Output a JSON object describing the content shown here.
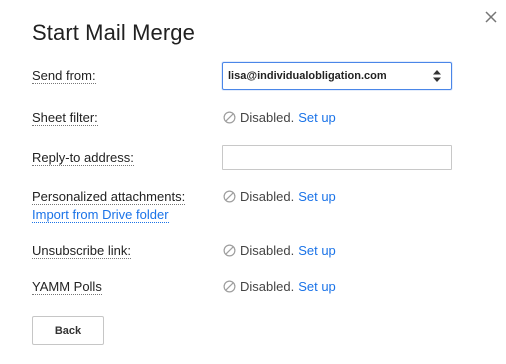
{
  "dialog": {
    "title": "Start Mail Merge",
    "close_icon": "close-icon"
  },
  "send_from": {
    "label": "Send from:",
    "selected_value": "lisa@individualobligation.com"
  },
  "sheet_filter": {
    "label": "Sheet filter:",
    "status": "Disabled.",
    "setup_link": "Set up"
  },
  "reply_to": {
    "label": "Reply-to address:",
    "value": "",
    "placeholder": ""
  },
  "personalized_attachments": {
    "label": "Personalized attachments:",
    "import_link": "Import from Drive folder",
    "status": "Disabled.",
    "setup_link": "Set up"
  },
  "unsubscribe_link": {
    "label": "Unsubscribe link:",
    "status": "Disabled.",
    "setup_link": "Set up"
  },
  "yamm_polls": {
    "label": "YAMM Polls",
    "status": "Disabled.",
    "setup_link": "Set up"
  },
  "footer": {
    "back_label": "Back"
  },
  "colors": {
    "link": "#1a73e8",
    "focus_border": "#4a86e8",
    "disabled_icon": "#9e9e9e"
  }
}
